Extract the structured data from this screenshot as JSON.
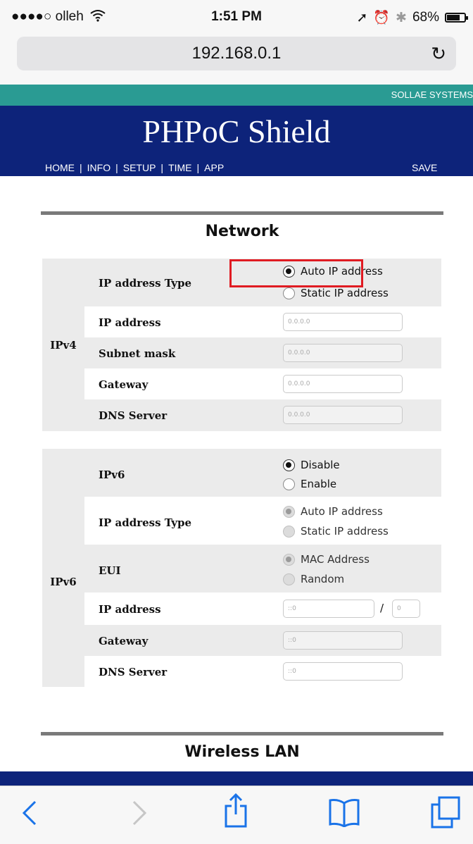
{
  "status_bar": {
    "carrier": "●●●●○ olleh",
    "time": "1:51 PM",
    "battery": "68%"
  },
  "browser": {
    "url": "192.168.0.1"
  },
  "header": {
    "brand": "SOLLAE SYSTEMS",
    "title": "PHPoC Shield",
    "nav": [
      "HOME",
      "INFO",
      "SETUP",
      "TIME",
      "APP"
    ],
    "save": "SAVE"
  },
  "network": {
    "title": "Network",
    "ipv4": {
      "group_label": "IPv4",
      "ip_type_label": "IP address Type",
      "ip_type_options": [
        "Auto IP address",
        "Static IP address"
      ],
      "ip_type_selected": "Auto IP address",
      "ip_address_label": "IP address",
      "ip_address_value": "0.0.0.0",
      "subnet_label": "Subnet mask",
      "subnet_value": "0.0.0.0",
      "gateway_label": "Gateway",
      "gateway_value": "0.0.0.0",
      "dns_label": "DNS Server",
      "dns_value": "0.0.0.0"
    },
    "ipv6": {
      "group_label": "IPv6",
      "ipv6_label": "IPv6",
      "ipv6_options": [
        "Disable",
        "Enable"
      ],
      "ipv6_selected": "Disable",
      "ip_type_label": "IP address Type",
      "ip_type_options": [
        "Auto IP address",
        "Static IP address"
      ],
      "eui_label": "EUI",
      "eui_options": [
        "MAC Address",
        "Random"
      ],
      "ip_address_label": "IP address",
      "ip_address_value": "::0",
      "prefix_sep": "/",
      "prefix_value": "0",
      "gateway_label": "Gateway",
      "gateway_value": "::0",
      "dns_label": "DNS Server",
      "dns_value": "::0"
    }
  },
  "wireless": {
    "title": "Wireless LAN"
  },
  "toolbar_icons": [
    "back-icon",
    "forward-icon",
    "share-icon",
    "bookmarks-icon",
    "tabs-icon"
  ]
}
